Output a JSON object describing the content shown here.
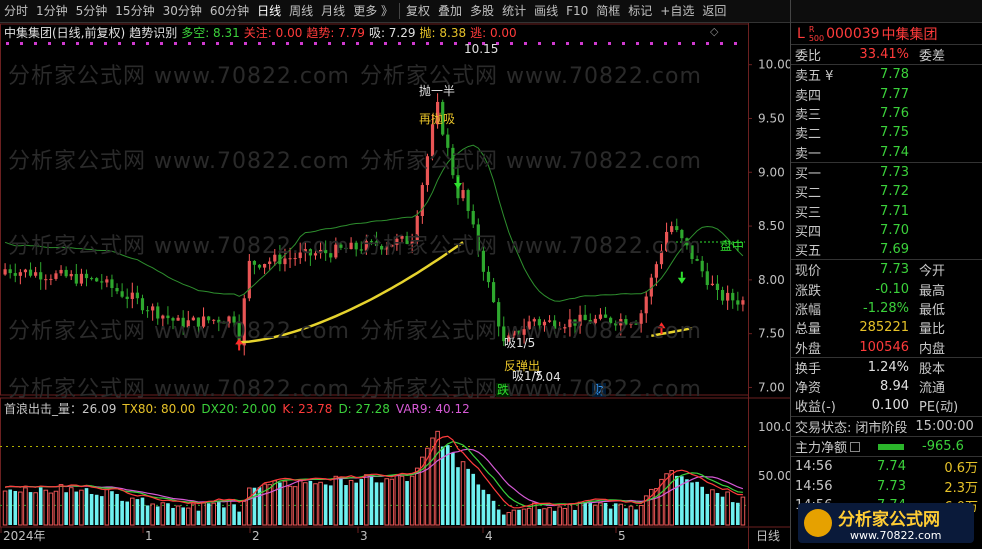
{
  "toolbar": {
    "periods": [
      "分时",
      "1分钟",
      "5分钟",
      "15分钟",
      "30分钟",
      "60分钟",
      "日线",
      "周线",
      "月线",
      "更多 》"
    ],
    "active_period": "日线",
    "actions": [
      "复权",
      "叠加",
      "多股",
      "统计",
      "画线",
      "F10",
      "简框",
      "标记",
      "+自选",
      "返回"
    ]
  },
  "main_legend": {
    "title": "中集集团(日线,前复权)",
    "indicator": "趋势识别",
    "items": [
      {
        "label": "多空: 8.31",
        "color": "#3bd13b"
      },
      {
        "label": "关注: 0.00",
        "color": "#ff3b3b"
      },
      {
        "label": "趋势: 7.79",
        "color": "#ff3b3b"
      },
      {
        "label": "吸: 7.29",
        "color": "#e0e0e0"
      },
      {
        "label": "抛: 8.38",
        "color": "#e6c229"
      },
      {
        "label": "逃: 0.00",
        "color": "#ff3b3b"
      }
    ]
  },
  "sub_legend": {
    "items": [
      {
        "label": "首浪出击_量：26.09",
        "color": "#c8c8c8"
      },
      {
        "label": "TX80: 80.00",
        "color": "#e6c229"
      },
      {
        "label": "DX20: 20.00",
        "color": "#3bd13b"
      },
      {
        "label": "K: 23.78",
        "color": "#ff3b3b"
      },
      {
        "label": "D: 27.28",
        "color": "#3bd13b"
      },
      {
        "label": "VAR9: 40.12",
        "color": "#d65ad6"
      }
    ]
  },
  "annotations": {
    "high_price": "10.15",
    "low_price": "7.04",
    "sell_half": "抛一半",
    "sell_again": "再抛吸",
    "buy_fifth": "吸1/5",
    "rebound_out": "反弹出",
    "buy_fifth_2": "吸1/5",
    "fall": "跌",
    "finance": "财",
    "rise": "盘中"
  },
  "axis": {
    "price_ticks": [
      "10.00",
      "9.50",
      "9.00",
      "8.50",
      "8.00",
      "7.50",
      "7.00"
    ],
    "sub_ticks": [
      "100.0",
      "50.00"
    ],
    "x_labels": [
      "2024年",
      "1",
      "2",
      "3",
      "4",
      "5"
    ],
    "x_right": "日线"
  },
  "watermark": "分析家公式网 www.70822.com",
  "stock": {
    "code": "000039",
    "name": "中集集团",
    "badge_l": "L",
    "badge_r": "R",
    "badge_num": "500"
  },
  "order_book": {
    "webi_label": "委比",
    "webi_value": "33.41%",
    "weicha_label": "委差",
    "asks": [
      {
        "label": "卖五 ¥",
        "price": "7.78"
      },
      {
        "label": "卖四",
        "price": "7.77"
      },
      {
        "label": "卖三",
        "price": "7.76"
      },
      {
        "label": "卖二",
        "price": "7.75"
      },
      {
        "label": "卖一",
        "price": "7.74"
      }
    ],
    "bids": [
      {
        "label": "买一",
        "price": "7.73"
      },
      {
        "label": "买二",
        "price": "7.72"
      },
      {
        "label": "买三",
        "price": "7.71"
      },
      {
        "label": "买四",
        "price": "7.70"
      },
      {
        "label": "买五",
        "price": "7.69"
      }
    ]
  },
  "quote": [
    {
      "label": "现价",
      "value": "7.73",
      "color": "green",
      "label2": "今开"
    },
    {
      "label": "涨跌",
      "value": "-0.10",
      "color": "green",
      "label2": "最高"
    },
    {
      "label": "涨幅",
      "value": "-1.28%",
      "color": "green",
      "label2": "最低"
    },
    {
      "label": "总量",
      "value": "285221",
      "color": "yellow",
      "label2": "量比"
    },
    {
      "label": "外盘",
      "value": "100546",
      "color": "red",
      "label2": "内盘"
    }
  ],
  "extra": [
    {
      "label": "换手",
      "value": "1.24%",
      "label2": "股本"
    },
    {
      "label": "净资",
      "value": "8.94",
      "label2": "流通"
    },
    {
      "label": "收益(-)",
      "value": "0.100",
      "label2": "PE(动)"
    }
  ],
  "trade_status": {
    "label": "交易状态:",
    "value": "闭市阶段",
    "time": "15:00:00"
  },
  "main_flow": {
    "label": "主力净额",
    "value": "-965.6"
  },
  "ticks": [
    {
      "time": "14:56",
      "price": "7.74",
      "vol": "0.6万"
    },
    {
      "time": "14:56",
      "price": "7.73",
      "vol": "2.3万"
    },
    {
      "time": "14:56",
      "price": "7.74",
      "vol": "6.0万"
    }
  ],
  "logo": {
    "text": "分析家公式网",
    "url": "www.70822.com"
  }
}
